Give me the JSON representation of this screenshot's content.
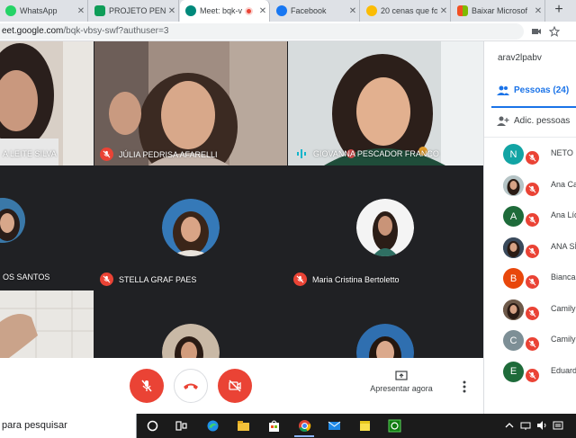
{
  "browser": {
    "tabs": [
      {
        "label": "WhatsApp",
        "icon": "whatsapp-icon",
        "color": "#25d366",
        "active": false
      },
      {
        "label": "PROJETO PENSA",
        "icon": "sheets-icon",
        "color": "#0f9d58",
        "active": false
      },
      {
        "label": "Meet: bqk-v",
        "icon": "meet-icon",
        "color": "#00897b",
        "active": true,
        "recording": true
      },
      {
        "label": "Facebook",
        "icon": "facebook-icon",
        "color": "#1877f2",
        "active": false
      },
      {
        "label": "20 cenas que fo",
        "icon": "news-icon",
        "color": "#fbbc04",
        "active": false
      },
      {
        "label": "Baixar Microsof",
        "icon": "microsoft-icon",
        "color": "#f25022",
        "active": false
      }
    ],
    "new_tab": "+",
    "url_host": "eet.google.com",
    "url_path": "/bqk-vbsy-swf?authuser=3"
  },
  "meeting": {
    "tiles": [
      {
        "name": "A LEITE SILVA",
        "mic": "off"
      },
      {
        "name": "JÚLIA PEDRISA AFARELLI",
        "mic": "off"
      },
      {
        "name": "GIOVANNA PESCADOR FRANCO",
        "mic": "speaking"
      },
      {
        "name": "OS SANTOS",
        "mic": "none"
      },
      {
        "name": "STELLA GRAF PAES",
        "mic": "off"
      },
      {
        "name": "Maria Cristina Bertoletto",
        "mic": "off"
      },
      {
        "name": "",
        "mic": "none"
      },
      {
        "name": "",
        "mic": "none"
      },
      {
        "name": "",
        "mic": "none"
      }
    ],
    "speaking_color": "#12b5cb",
    "muted_color": "#ea4335"
  },
  "controls": {
    "mic_button": "microphone-off-icon",
    "hangup_button": "hang-up-icon",
    "camera_button": "camera-off-icon",
    "present_label": "Apresentar agora",
    "more_button": "more-vert-icon"
  },
  "panel": {
    "meet_code": "arav2lpabv",
    "people_tab": "Pessoas (24)",
    "add_people": "Adic. pessoas",
    "participants": [
      {
        "name": "NETO",
        "initial": "N",
        "color": "#12a4a4",
        "photo": false
      },
      {
        "name": "Ana Ca",
        "initial": "",
        "color": "#b5c4c6",
        "photo": true
      },
      {
        "name": "Ana Lídi",
        "initial": "A",
        "color": "#1e6b3a",
        "photo": false
      },
      {
        "name": "ANA SÍL",
        "initial": "",
        "color": "#3a4a5c",
        "photo": true
      },
      {
        "name": "Bianca",
        "initial": "B",
        "color": "#e8470b",
        "photo": false
      },
      {
        "name": "Camily",
        "initial": "",
        "color": "#6e5a4a",
        "photo": true
      },
      {
        "name": "Camily",
        "initial": "C",
        "color": "#7d8f96",
        "photo": false
      },
      {
        "name": "Eduard",
        "initial": "E",
        "color": "#1e6b3a",
        "photo": false
      }
    ]
  },
  "taskbar": {
    "search_placeholder": "para pesquisar",
    "icons": [
      "cortana-icon",
      "task-view-icon",
      "edge-icon",
      "file-explorer-icon",
      "store-icon",
      "chrome-icon",
      "mail-icon",
      "sticky-notes-icon",
      "xbox-icon"
    ],
    "tray": [
      "chevron-up-icon",
      "network-icon",
      "volume-icon",
      "language-icon"
    ]
  }
}
